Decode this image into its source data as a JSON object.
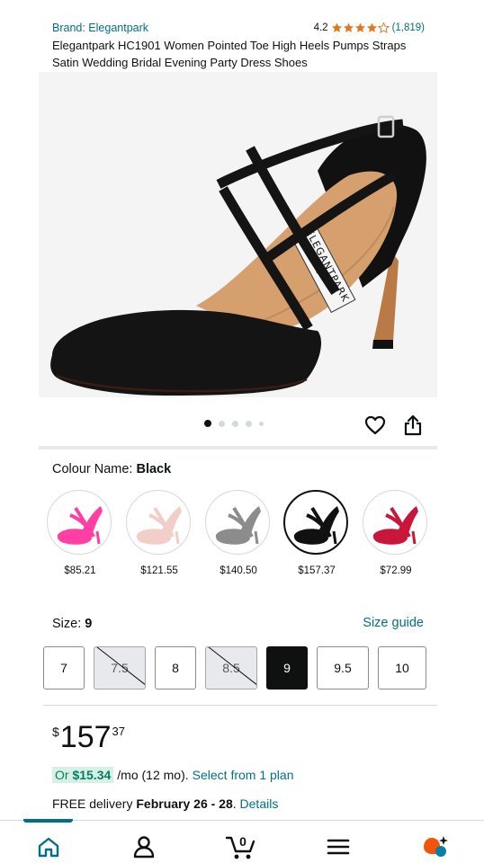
{
  "product": {
    "brand": "Brand: Elegantpark",
    "rating_value": "4.2",
    "rating_stars": 4.2,
    "rating_count": "(1,819)",
    "title": "Elegantpark HC1901 Women Pointed Toe High Heels Pumps Straps Satin Wedding Bridal Evening Party Dress Shoes",
    "image_logo_text": "ELEGANTPARK"
  },
  "carousel": {
    "count": 5,
    "active_index": 0
  },
  "colour": {
    "label": "Colour Name:",
    "selected": "Black",
    "options": [
      {
        "price": "$85.21",
        "color": "#ff3fa4"
      },
      {
        "price": "$121.55",
        "color": "#f1cfc8"
      },
      {
        "price": "$140.50",
        "color": "#8c8c8c"
      },
      {
        "price": "$157.37",
        "color": "#111111"
      },
      {
        "price": "$72.99",
        "color": "#c8173a"
      }
    ]
  },
  "size": {
    "label": "Size:",
    "selected": "9",
    "guide": "Size guide",
    "options": [
      {
        "label": "7",
        "state": "available"
      },
      {
        "label": "7.5",
        "state": "unavailable"
      },
      {
        "label": "8",
        "state": "available"
      },
      {
        "label": "8.5",
        "state": "unavailable"
      },
      {
        "label": "9",
        "state": "selected"
      },
      {
        "label": "9.5",
        "state": "available"
      },
      {
        "label": "10",
        "state": "available"
      }
    ]
  },
  "price": {
    "symbol": "$",
    "whole": "157",
    "fraction": "37"
  },
  "monthly": {
    "or": "Or",
    "amount": "$15.34",
    "term": "/mo (12 mo).",
    "link": "Select from 1 plan"
  },
  "delivery": {
    "prefix": "FREE delivery",
    "dates": "February 26 - 28",
    "suffix": ".",
    "link": "Details"
  },
  "nav": {
    "cart_count": "0",
    "items": [
      "home-icon",
      "account-icon",
      "cart-icon",
      "menu-icon",
      "rufus-icon"
    ]
  },
  "colors": {
    "link": "#007185",
    "star": "#de7921",
    "highlight_bg": "#d6f0e6",
    "highlight_text": "#067d62"
  }
}
